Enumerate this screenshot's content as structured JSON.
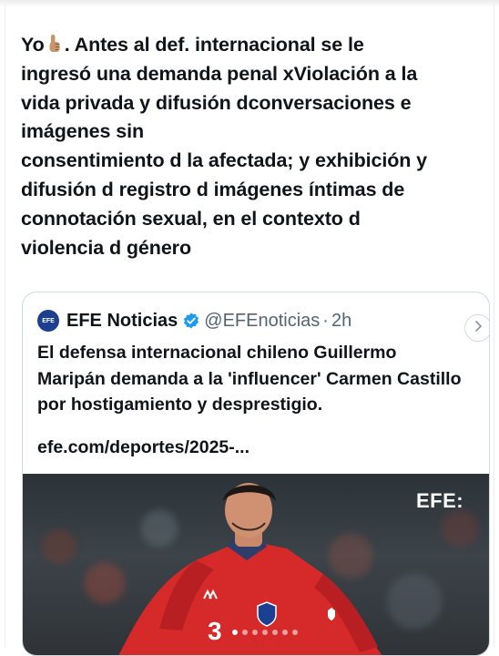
{
  "post": {
    "text_before_emoji": "Yo",
    "emoji": "pointing-up-finger",
    "text_after_emoji": ". Antes al def. internacional se le\ningresó una demanda penal xViolación a la\nvida privada y difusión dconversaciones e\nimágenes sin\nconsentimiento d la afectada; y exhibición y\ndifusión d registro d imágenes íntimas de\nconnotación sexual, en el contexto d\nviolencia d género"
  },
  "quote": {
    "avatar_text": "EFE",
    "author_name": "EFE Noticias",
    "verified": true,
    "handle": "@EFEnoticias",
    "separator": "·",
    "time": "2h",
    "text": "El defensa internacional chileno Guillermo Maripán demanda a la 'influencer' Carmen Castillo por hostigamiento y desprestigio.",
    "link": "efe.com/deportes/2025-...",
    "media": {
      "watermark": "EFE:",
      "player_number": "3",
      "carousel_count": 7,
      "carousel_active": 0
    }
  },
  "colors": {
    "text": "#0f1419",
    "secondary_text": "#536471",
    "border": "#cfd9de",
    "verified_badge": "#1d9bf0",
    "jersey_red": "#d62a2a",
    "avatar_blue": "#1d3f8f"
  },
  "icons": {
    "verified": "verified-badge-icon",
    "next": "chevron-right-icon",
    "emoji": "pointing-up-finger-icon"
  }
}
